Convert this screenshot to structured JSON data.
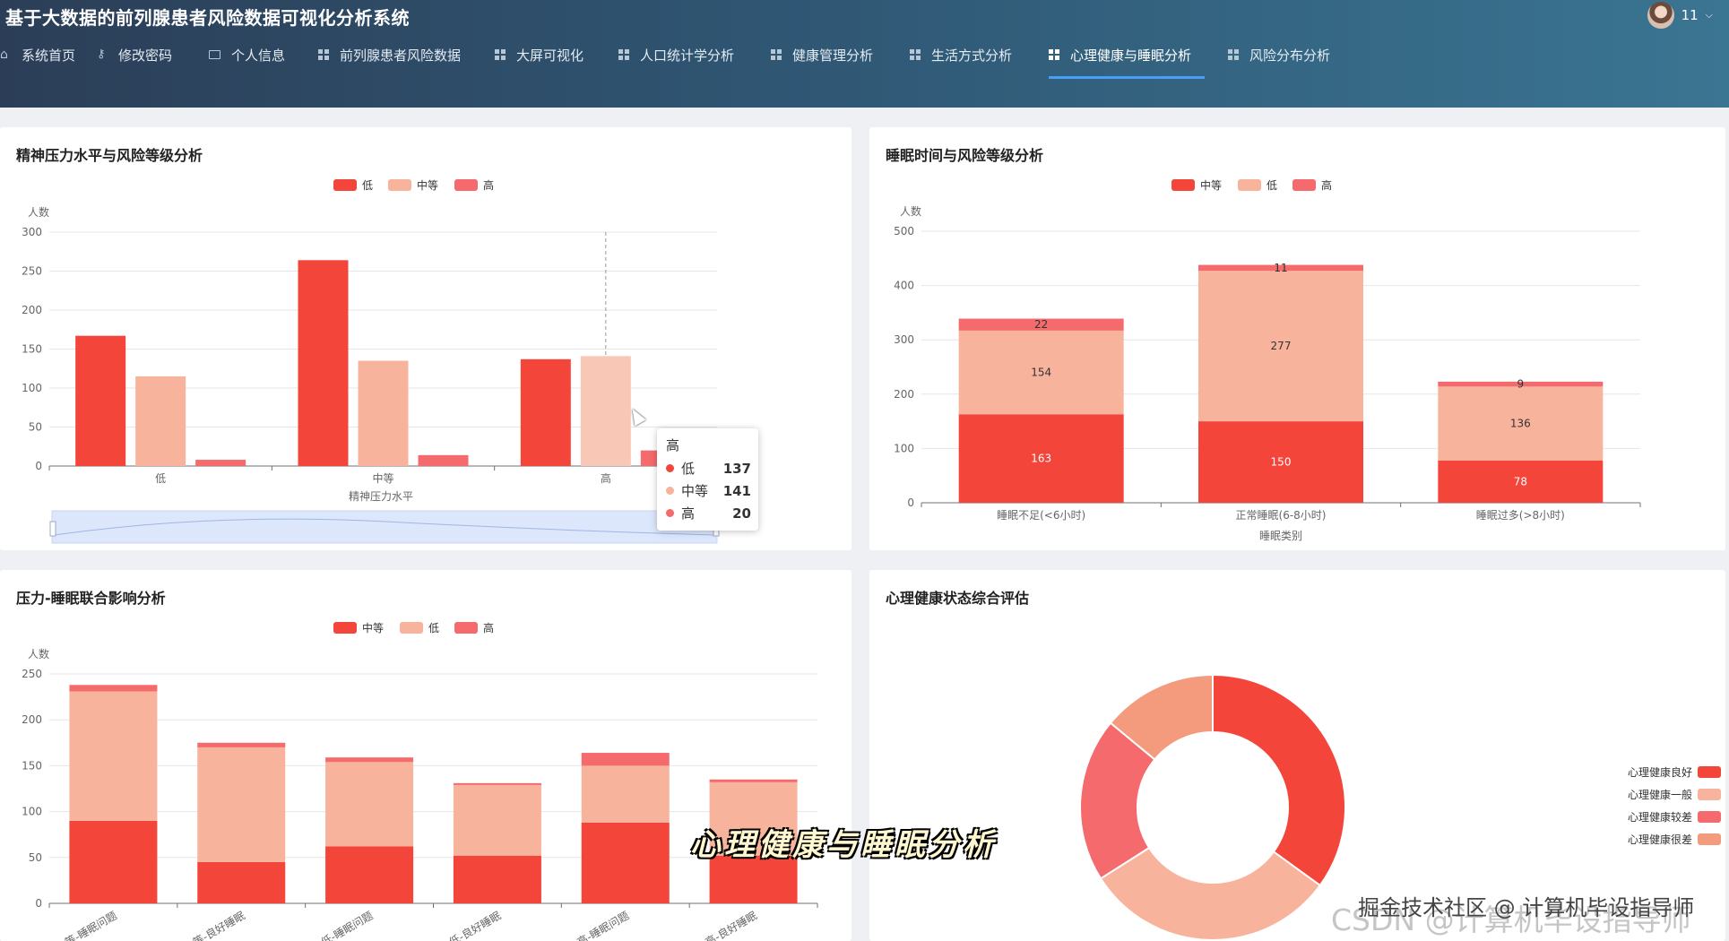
{
  "header": {
    "app_title": "基于大数据的前列腺患者风险数据可视化分析系统",
    "user_name": "11",
    "nav": [
      {
        "label": "系统首页",
        "icon": "home-icon"
      },
      {
        "label": "修改密码",
        "icon": "lock-icon"
      },
      {
        "label": "个人信息",
        "icon": "id-card-icon"
      },
      {
        "label": "前列腺患者风险数据",
        "icon": "grid-icon"
      },
      {
        "label": "大屏可视化",
        "icon": "grid-icon"
      },
      {
        "label": "人口统计学分析",
        "icon": "grid-icon"
      },
      {
        "label": "健康管理分析",
        "icon": "grid-icon"
      },
      {
        "label": "生活方式分析",
        "icon": "grid-icon"
      },
      {
        "label": "心理健康与睡眠分析",
        "icon": "grid-icon",
        "active": true
      },
      {
        "label": "风险分布分析",
        "icon": "grid-icon"
      }
    ]
  },
  "colors": {
    "c1": "#f4453a",
    "c2": "#f8b39c",
    "c3": "#f56a6c",
    "c4": "#f49a7d"
  },
  "chart_data": [
    {
      "title": "精神压力水平与风险等级分析",
      "type": "bar",
      "legend": [
        "低",
        "中等",
        "高"
      ],
      "ylabel": "人数",
      "xlabel": "精神压力水平",
      "ylim": [
        0,
        300
      ],
      "yticks": [
        0,
        50,
        100,
        150,
        200,
        250,
        300
      ],
      "categories": [
        "低",
        "中等",
        "高"
      ],
      "series": [
        {
          "name": "低",
          "values": [
            167,
            264,
            137
          ]
        },
        {
          "name": "中等",
          "values": [
            115,
            135,
            141
          ]
        },
        {
          "name": "高",
          "values": [
            8,
            14,
            20
          ]
        }
      ],
      "tooltip": {
        "title": "高",
        "rows": [
          {
            "name": "低",
            "value": "137"
          },
          {
            "name": "中等",
            "value": "141"
          },
          {
            "name": "高",
            "value": "20"
          }
        ]
      }
    },
    {
      "title": "睡眠时间与风险等级分析",
      "type": "bar",
      "stacked": true,
      "legend": [
        "中等",
        "低",
        "高"
      ],
      "ylabel": "人数",
      "xlabel": "睡眠类别",
      "ylim": [
        0,
        500
      ],
      "yticks": [
        0,
        100,
        200,
        300,
        400,
        500
      ],
      "categories": [
        "睡眠不足(<6小时)",
        "正常睡眠(6-8小时)",
        "睡眠过多(>8小时)"
      ],
      "series": [
        {
          "name": "中等",
          "values": [
            163,
            150,
            78
          ]
        },
        {
          "name": "低",
          "values": [
            154,
            277,
            136
          ]
        },
        {
          "name": "高",
          "values": [
            22,
            11,
            9
          ]
        }
      ]
    },
    {
      "title": "压力-睡眠联合影响分析",
      "type": "bar",
      "stacked": true,
      "legend": [
        "中等",
        "低",
        "高"
      ],
      "ylabel": "人数",
      "ylim": [
        0,
        250
      ],
      "yticks": [
        0,
        50,
        100,
        150,
        200,
        250
      ],
      "categories": [
        "中等-睡眠问题",
        "中等-良好睡眠",
        "低-睡眠问题",
        "低-良好睡眠",
        "高-睡眠问题",
        "高-良好睡眠"
      ],
      "series": [
        {
          "name": "中等",
          "values": [
            90,
            45,
            62,
            52,
            88,
            52
          ]
        },
        {
          "name": "低",
          "values": [
            141,
            125,
            92,
            77,
            62,
            80
          ]
        },
        {
          "name": "高",
          "values": [
            7,
            5,
            5,
            2,
            14,
            3
          ]
        }
      ]
    },
    {
      "title": "心理健康状态综合评估",
      "type": "pie",
      "donut": true,
      "legend": [
        "心理健康良好",
        "心理健康一般",
        "心理健康较差",
        "心理健康很差"
      ],
      "values": [
        35,
        31,
        20,
        14
      ]
    }
  ],
  "caption": "心理健康与睡眠分析",
  "watermark": "CSDN @计算机毕设指导师",
  "watermark_front": "掘金技术社区 @ 计算机毕设指导师"
}
